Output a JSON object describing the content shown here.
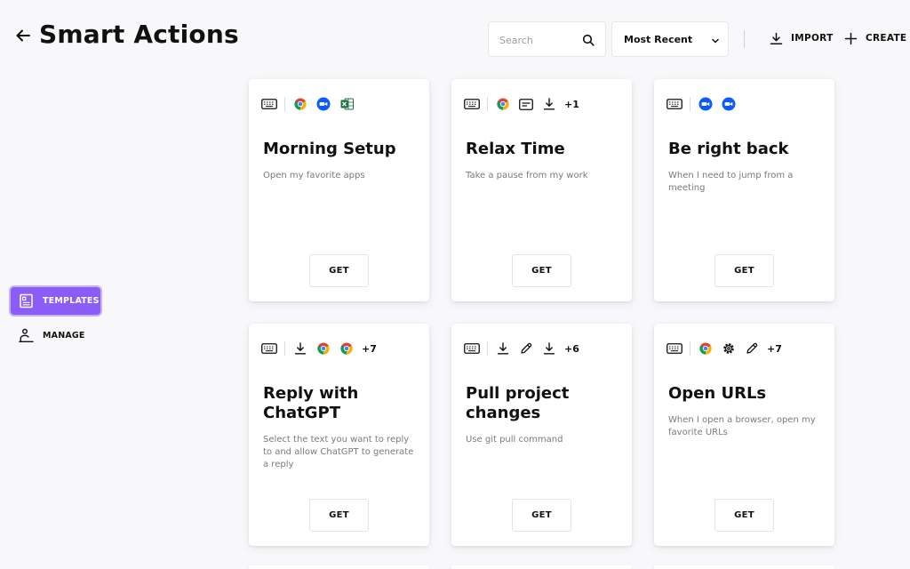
{
  "header": {
    "title": "Smart Actions",
    "search_placeholder": "Search",
    "sort_value": "Most Recent",
    "import_label": "IMPORT",
    "create_label": "CREATE"
  },
  "sidebar": {
    "items": [
      {
        "label": "TEMPLATES",
        "icon": "templates-icon",
        "active": true
      },
      {
        "label": "MANAGE",
        "icon": "manage-icon",
        "active": false
      }
    ]
  },
  "colors": {
    "accent": "#8b5cf6",
    "zoom": "#0b5cff",
    "excel": "#1d6f42"
  },
  "cards": [
    {
      "title": "Morning Setup",
      "description": "Open my favorite apps",
      "icons": [
        "keyboard-icon",
        "chrome-icon",
        "zoom-icon",
        "excel-icon"
      ],
      "more": "",
      "button": "GET"
    },
    {
      "title": "Relax Time",
      "description": "Take a pause from my work",
      "icons": [
        "keyboard-icon",
        "chrome-icon",
        "window-icon",
        "download-icon"
      ],
      "more": "+1",
      "button": "GET"
    },
    {
      "title": "Be right back",
      "description": "When I need to jump from a meeting",
      "icons": [
        "keyboard-icon",
        "zoom-icon",
        "zoom-icon"
      ],
      "more": "",
      "button": "GET"
    },
    {
      "title": "Reply with ChatGPT",
      "description": "Select the text you want to reply to and allow ChatGPT to generate a reply",
      "icons": [
        "keyboard-icon",
        "download-icon",
        "chrome-icon",
        "chrome-icon"
      ],
      "more": "+7",
      "button": "GET"
    },
    {
      "title": "Pull project changes",
      "description": "Use git pull command",
      "icons": [
        "keyboard-icon",
        "download-icon",
        "pencil-icon",
        "download-icon"
      ],
      "more": "+6",
      "button": "GET"
    },
    {
      "title": "Open URLs",
      "description": "When I open a browser, open my favorite URLs",
      "icons": [
        "keyboard-icon",
        "chrome-icon",
        "gear-icon",
        "pencil-icon"
      ],
      "more": "+7",
      "button": "GET"
    }
  ]
}
